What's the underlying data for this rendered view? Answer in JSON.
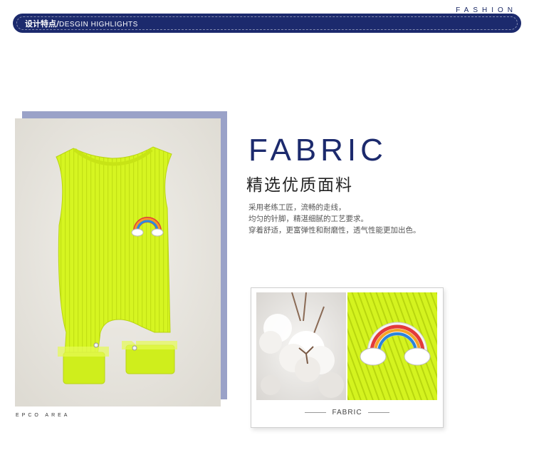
{
  "header": {
    "brand_label": "FASHION",
    "banner_cn": "设计特点/",
    "banner_en": "DESGIN HIGHLIGHTS"
  },
  "photo": {
    "corner_label": "EPCO AREA"
  },
  "fabric": {
    "title": "FABRIC",
    "subtitle": "精选优质面料",
    "description": [
      "采用老练工匠，流畅的走线，",
      "均匀的针脚，精湛细腻的工艺要求。",
      "穿着舒适，更富弹性和耐磨性，透气性能更加出色。"
    ]
  },
  "detail_card": {
    "caption": "FABRIC"
  },
  "colors": {
    "navy": "#1c2a6d",
    "shadow_block": "#9aa2c8",
    "romper_green": "#d7f524"
  },
  "icons": [
    "rainbow-patch-icon"
  ]
}
